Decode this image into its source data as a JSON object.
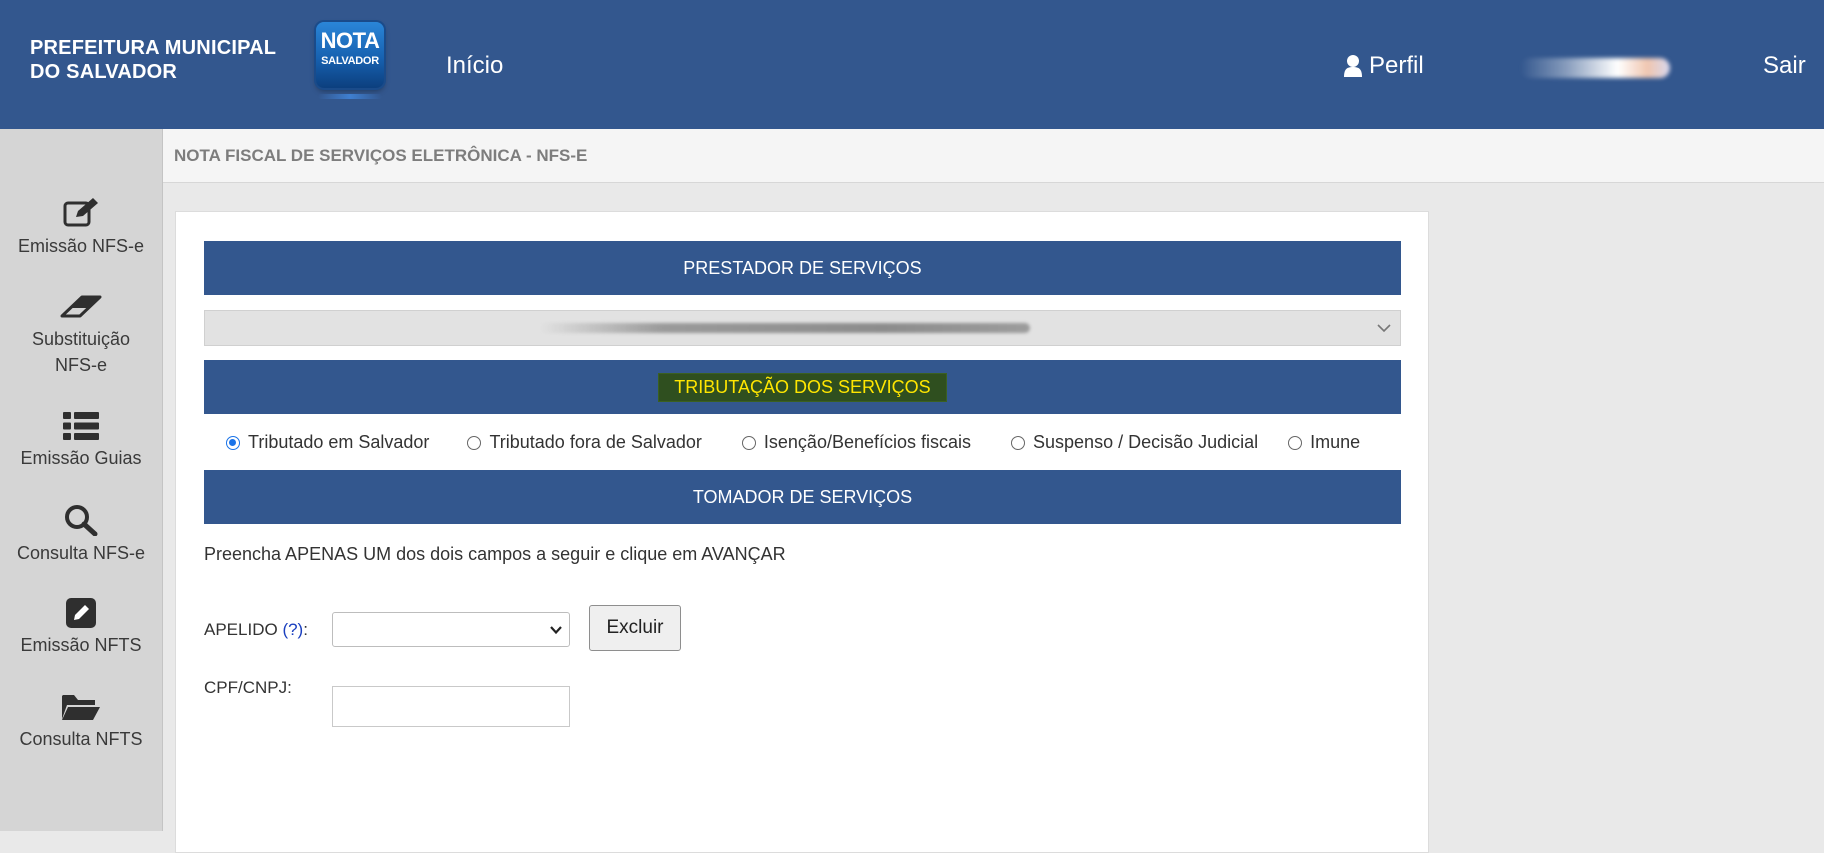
{
  "header": {
    "brand_line1": "PREFEITURA MUNICIPAL",
    "brand_line2": "DO SALVADOR",
    "logo_line1": "NOTA",
    "logo_line2": "SALVADOR",
    "nav_inicio": "Início",
    "nav_perfil": "Perfil",
    "nav_sair": "Sair",
    "bg_color": "#33578e"
  },
  "subheader": {
    "title": "NOTA FISCAL DE SERVIÇOS ELETRÔNICA - NFS-E"
  },
  "sidebar": {
    "items": [
      {
        "label": "Emissão NFS-e",
        "icon": "edit-icon"
      },
      {
        "label": "Substituição NFS-e",
        "icon": "eraser-icon"
      },
      {
        "label": "Emissão Guias",
        "icon": "list-icon"
      },
      {
        "label": "Consulta NFS-e",
        "icon": "search-icon"
      },
      {
        "label": "Emissão NFTS",
        "icon": "pencil-square-icon"
      },
      {
        "label": "Consulta NFTS",
        "icon": "folder-open-icon"
      }
    ]
  },
  "form": {
    "prestador_heading": "PRESTADOR DE SERVIÇOS",
    "tributacao_heading": "TRIBUTAÇÃO DOS SERVIÇOS",
    "tomador_heading": "TOMADOR DE SERVIÇOS",
    "tributacao_options": [
      {
        "label": "Tributado em Salvador",
        "checked": true
      },
      {
        "label": "Tributado fora de Salvador",
        "checked": false
      },
      {
        "label": "Isenção/Benefícios fiscais",
        "checked": false
      },
      {
        "label": "Suspenso / Decisão Judicial",
        "checked": false
      },
      {
        "label": "Imune",
        "checked": false
      }
    ],
    "instruction": "Preencha APENAS UM dos dois campos a seguir e clique em AVANÇAR",
    "apelido_label": "APELIDO",
    "apelido_help": "(?)",
    "apelido_colon": ":",
    "apelido_value": "",
    "excluir_label": "Excluir",
    "cpf_label": "CPF/CNPJ:",
    "cpf_value": ""
  },
  "colors": {
    "accent": "#33578e",
    "highlight_bg": "#2f4f1f",
    "highlight_text": "#ffe600",
    "radio_checked": "#1a73e8"
  }
}
